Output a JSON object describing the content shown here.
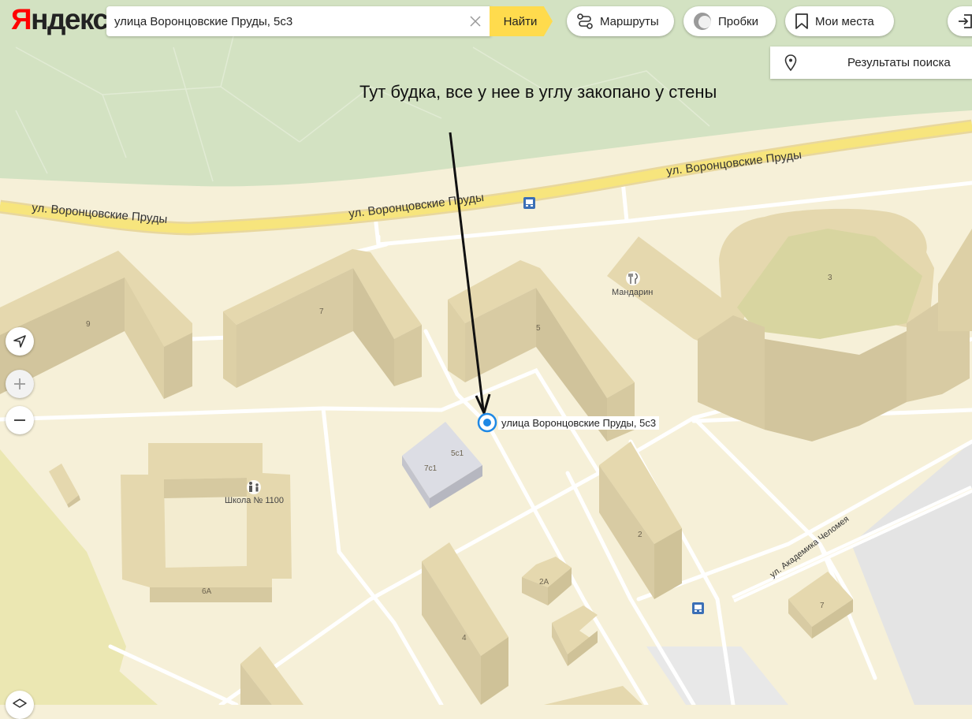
{
  "header": {
    "logo_first": "Я",
    "logo_rest": "ндекс",
    "search_value": "улица Воронцовские Пруды, 5с3",
    "find_label": "Найти",
    "routes_label": "Маршруты",
    "traffic_label": "Пробки",
    "places_label": "Мои места"
  },
  "results_panel": {
    "label": "Результаты поиска"
  },
  "annotation": {
    "text": "Тут будка, все у нее в углу закопано у стены"
  },
  "marker": {
    "label": "улица Воронцовские Пруды, 5с3"
  },
  "map": {
    "streets": {
      "main_left": "ул. Воронцовские Пруды",
      "main_center": "ул. Воронцовские Пруды",
      "main_right": "ул. Воронцовские Пруды",
      "chelomeya": "ул. Академика Челомея"
    },
    "buildings": {
      "b9": "9",
      "b7": "7",
      "b5": "5",
      "b3": "3",
      "b5c1": "5с1",
      "b7c1": "7с1",
      "b6a": "6А",
      "b2": "2",
      "b2a": "2А",
      "b4": "4",
      "b7r": "7"
    },
    "pois": {
      "restaurant": "Мандарин",
      "school": "Школа № 1100"
    }
  },
  "colors": {
    "land": "#f6f0d8",
    "park": "#d3e2c2",
    "building_top": "#e7dbb3",
    "building_side": "#d2c59d",
    "road_main": "#f7dc6f",
    "accent": "#ffdb4d",
    "marker": "#1e88e5"
  }
}
